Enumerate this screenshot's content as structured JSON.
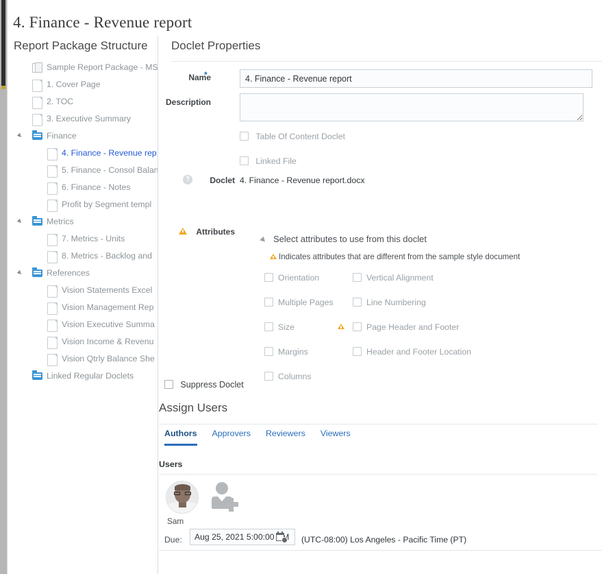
{
  "page": {
    "title": "4. Finance - Revenue report"
  },
  "tree": {
    "heading": "Report Package Structure",
    "items": [
      {
        "label": "Sample Report Package - MS",
        "icon": "package-icon",
        "indent": 36,
        "expandable": false,
        "selected": false
      },
      {
        "label": "1. Cover Page",
        "icon": "document-icon",
        "indent": 36,
        "expandable": false,
        "selected": false
      },
      {
        "label": "2. TOC",
        "icon": "document-icon",
        "indent": 36,
        "expandable": false,
        "selected": false
      },
      {
        "label": "3. Executive Summary",
        "icon": "document-icon",
        "indent": 36,
        "expandable": false,
        "selected": false
      },
      {
        "label": "Finance",
        "icon": "folder-icon",
        "indent": 36,
        "expandable": true,
        "selected": false
      },
      {
        "label": "4. Finance - Revenue rep",
        "icon": "document-icon",
        "indent": 58,
        "expandable": false,
        "selected": true
      },
      {
        "label": "5. Finance - Consol Balan",
        "icon": "document-icon",
        "indent": 58,
        "expandable": false,
        "selected": false
      },
      {
        "label": "6. Finance - Notes",
        "icon": "document-icon",
        "indent": 58,
        "expandable": false,
        "selected": false
      },
      {
        "label": "Profit by Segment templ",
        "icon": "document-icon",
        "indent": 58,
        "expandable": false,
        "selected": false
      },
      {
        "label": "Metrics",
        "icon": "folder-icon",
        "indent": 36,
        "expandable": true,
        "selected": false
      },
      {
        "label": "7. Metrics - Units",
        "icon": "document-icon",
        "indent": 58,
        "expandable": false,
        "selected": false
      },
      {
        "label": "8. Metrics - Backlog and",
        "icon": "document-icon",
        "indent": 58,
        "expandable": false,
        "selected": false
      },
      {
        "label": "References",
        "icon": "folder-icon",
        "indent": 36,
        "expandable": true,
        "selected": false
      },
      {
        "label": "Vision Statements Excel",
        "icon": "document-icon",
        "indent": 58,
        "expandable": false,
        "selected": false
      },
      {
        "label": "Vision Management Rep",
        "icon": "document-icon",
        "indent": 58,
        "expandable": false,
        "selected": false
      },
      {
        "label": "Vision Executive Summa",
        "icon": "document-icon",
        "indent": 58,
        "expandable": false,
        "selected": false
      },
      {
        "label": "Vision Income & Revenu",
        "icon": "document-icon",
        "indent": 58,
        "expandable": false,
        "selected": false
      },
      {
        "label": "Vision Qtrly Balance She",
        "icon": "document-icon",
        "indent": 58,
        "expandable": false,
        "selected": false
      },
      {
        "label": "Linked Regular Doclets",
        "icon": "folder-icon",
        "indent": 36,
        "expandable": false,
        "selected": false
      }
    ]
  },
  "detail": {
    "heading": "Doclet Properties",
    "name_label": "Name",
    "name_required_marker": "*",
    "name_value": "4. Finance - Revenue report",
    "description_label": "Description",
    "description_value": "",
    "description_placeholder": "",
    "toc_doclet_label": "Table Of Content Doclet",
    "linked_file_label": "Linked File",
    "doclet_label": "Doclet",
    "doclet_help_glyph": "?",
    "doclet_value": "4. Finance - Revenue report.docx",
    "attributes_label": "Attributes",
    "attributes_section_title": "Select attributes to use from this doclet",
    "attributes_note": "Indicates attributes that are different from the sample style document",
    "attributes_left": [
      {
        "label": "Orientation",
        "checked": false,
        "warn": false
      },
      {
        "label": "Multiple Pages",
        "checked": false,
        "warn": false
      },
      {
        "label": "Size",
        "checked": false,
        "warn": false
      },
      {
        "label": "Margins",
        "checked": false,
        "warn": false
      },
      {
        "label": "Columns",
        "checked": false,
        "warn": false
      }
    ],
    "attributes_right": [
      {
        "label": "Vertical Alignment",
        "checked": false,
        "warn": false
      },
      {
        "label": "Line Numbering",
        "checked": false,
        "warn": false
      },
      {
        "label": "Page Header and Footer",
        "checked": false,
        "warn": true
      },
      {
        "label": "Header and Footer Location",
        "checked": false,
        "warn": false
      }
    ],
    "suppress_doclet_label": "Suppress Doclet",
    "suppress_doclet_checked": false
  },
  "assign_users": {
    "heading": "Assign Users",
    "tabs": [
      {
        "label": "Authors",
        "active": true
      },
      {
        "label": "Approvers",
        "active": false
      },
      {
        "label": "Reviewers",
        "active": false
      },
      {
        "label": "Viewers",
        "active": false
      }
    ],
    "users_label": "Users",
    "user": {
      "name": "Sam",
      "avatar": "user-photo"
    },
    "add_user_icon": "add-user-icon",
    "due_label": "Due:",
    "due_value": "Aug 25, 2021 5:00:00 PM",
    "calendar_icon": "calendar-clock-icon",
    "timezone": "(UTC-08:00) Los Angeles - Pacific Time (PT)"
  },
  "colors": {
    "accent_blue": "#2a6ebb",
    "selected_tree_blue": "#2459d6",
    "folder_blue": "#3a95d6",
    "warning_amber": "#f0a922",
    "text_dark": "#31363a",
    "text_muted": "#9aa1a7",
    "divider": "#e4e7ea"
  }
}
